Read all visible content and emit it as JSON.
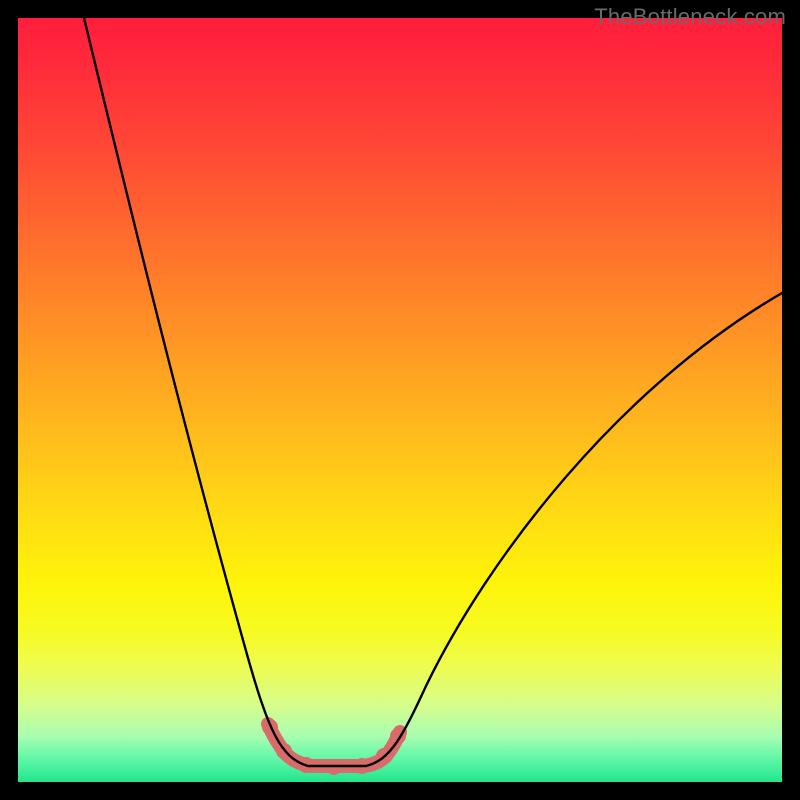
{
  "watermark": "TheBottleneck.com",
  "chart_data": {
    "type": "line",
    "title": "",
    "xlabel": "",
    "ylabel": "",
    "x": [
      0,
      0.05,
      0.1,
      0.15,
      0.2,
      0.25,
      0.3,
      0.33,
      0.36,
      0.38,
      0.4,
      0.42,
      0.45,
      0.48,
      0.52,
      0.56,
      0.6,
      0.65,
      0.7,
      0.75,
      0.8,
      0.85,
      0.9,
      0.95,
      1.0
    ],
    "values": [
      1.0,
      0.85,
      0.71,
      0.58,
      0.45,
      0.33,
      0.2,
      0.12,
      0.06,
      0.03,
      0.015,
      0.015,
      0.015,
      0.03,
      0.06,
      0.1,
      0.15,
      0.21,
      0.27,
      0.34,
      0.41,
      0.47,
      0.53,
      0.58,
      0.63
    ],
    "series": [
      {
        "name": "bottleneck-curve",
        "stroke": "#000000",
        "width": 2
      }
    ],
    "highlight": {
      "color": "#d96b6b",
      "range_x": [
        0.33,
        0.48
      ],
      "dots_x": [
        0.335,
        0.355,
        0.38,
        0.405,
        0.43,
        0.455,
        0.475
      ]
    },
    "xlim": [
      0,
      1
    ],
    "ylim": [
      0,
      1
    ],
    "grid": false,
    "legend": false,
    "background": "rainbow-gradient"
  }
}
